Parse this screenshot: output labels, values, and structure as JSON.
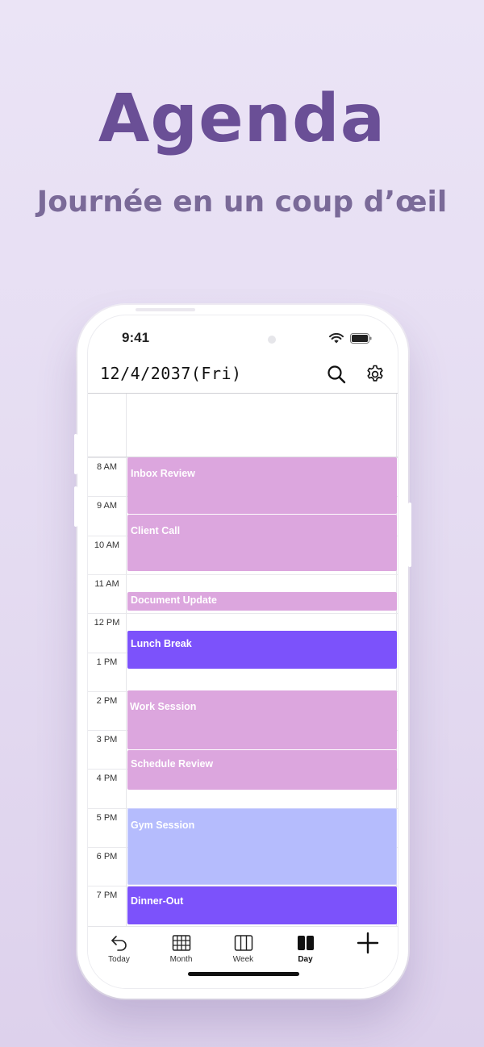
{
  "marketing": {
    "title": "Agenda",
    "subtitle": "Journée en un coup d’œil"
  },
  "status_bar": {
    "time": "9:41"
  },
  "header": {
    "date": "12/4/2037(Fri)",
    "search_icon": "search-icon",
    "settings_icon": "gear-icon"
  },
  "timeline": {
    "hours": [
      "8 AM",
      "9 AM",
      "10 AM",
      "11 AM",
      "12 PM",
      "1 PM",
      "2 PM",
      "3 PM",
      "4 PM",
      "5 PM",
      "6 PM",
      "7 PM"
    ]
  },
  "events": [
    {
      "title": "Inbox Review",
      "color": "#dca6de"
    },
    {
      "title": "Client Call",
      "color": "#dca6de"
    },
    {
      "title": "Document Update",
      "color": "#dca6de"
    },
    {
      "title": "Lunch Break",
      "color": "#7c52fb"
    },
    {
      "title": "Work Session",
      "color": "#dca6de"
    },
    {
      "title": "Schedule Review",
      "color": "#dca6de"
    },
    {
      "title": "Gym Session",
      "color": "#b5bcfd"
    },
    {
      "title": "Dinner-Out",
      "color": "#7c52fb"
    }
  ],
  "tabbar": {
    "today": "Today",
    "month": "Month",
    "week": "Week",
    "day": "Day",
    "add_icon": "plus-icon",
    "active": "Day"
  }
}
